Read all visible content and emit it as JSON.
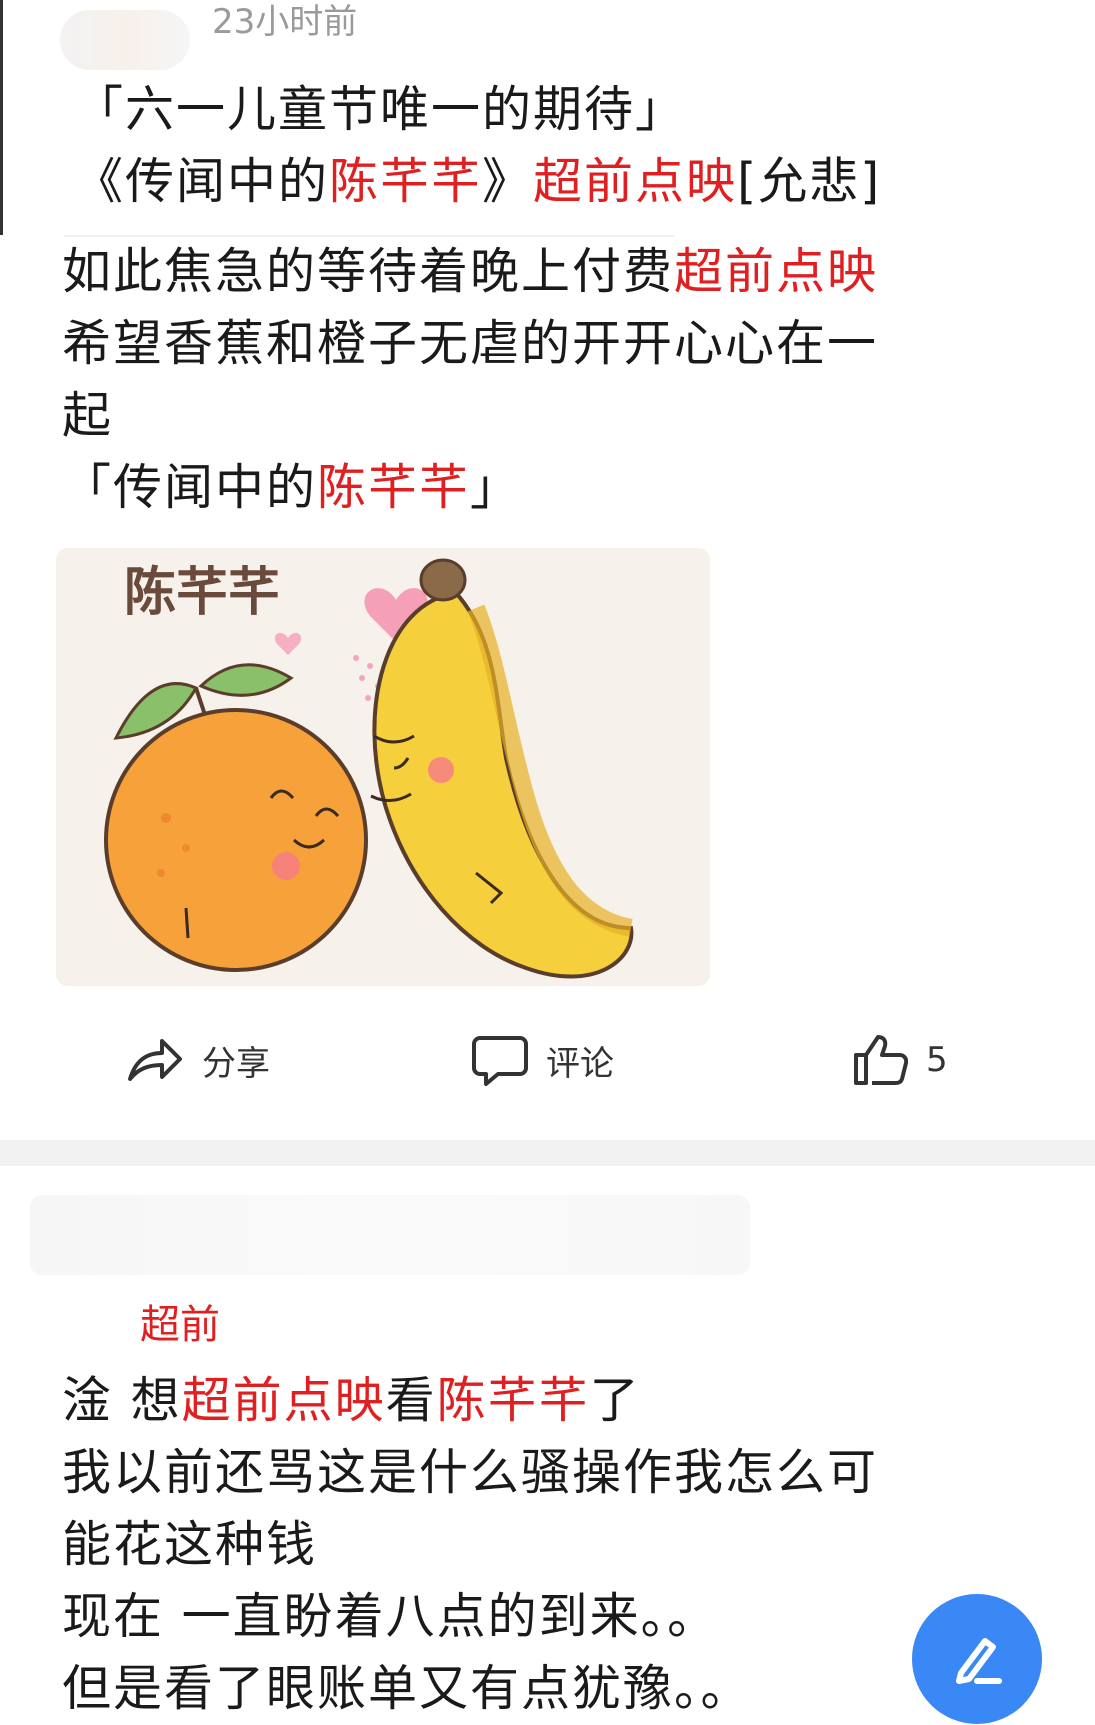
{
  "post1": {
    "timestamp": "23小时前",
    "title_line1": "「六一儿童节唯一的期待」",
    "title_line2": {
      "part1": "《传闻中的",
      "part2_highlight": "陈芊芊",
      "part3": "》",
      "part4_highlight": "超前点映",
      "part5": "[允悲]"
    },
    "body": {
      "l1_part1": "如此焦急的等待着晚上付费",
      "l1_highlight": "超前点映",
      "l2": "希望香蕉和橙子无虐的开开心心在一",
      "l3": "起",
      "l4_part1": "「传闻中的",
      "l4_highlight": "陈芊芊",
      "l4_part2": "」"
    },
    "image": {
      "title_text": "陈芊芊",
      "description_icon": "orange-and-banana-illustration"
    },
    "actions": {
      "share_label": "分享",
      "comment_label": "评论",
      "like_count": "5"
    }
  },
  "post2": {
    "cut_label": "超前",
    "body": {
      "l1_part1": "淦 想",
      "l1_highlight1": "超前点映",
      "l1_part2": "看",
      "l1_highlight2": "陈芊芊",
      "l1_part3": "了",
      "l2": "我以前还骂这是什么骚操作我怎么可",
      "l3": "能花这种钱",
      "l4": "现在 一直盼着八点的到来。。",
      "l5": "但是看了眼账单又有点犹豫。。"
    }
  },
  "colors": {
    "highlight": "#e02020",
    "fab": "#3a88f5"
  },
  "icons": {
    "share": "share-arrow-icon",
    "comment": "comment-bubble-icon",
    "like": "thumbs-up-icon",
    "fab": "pen-icon"
  }
}
